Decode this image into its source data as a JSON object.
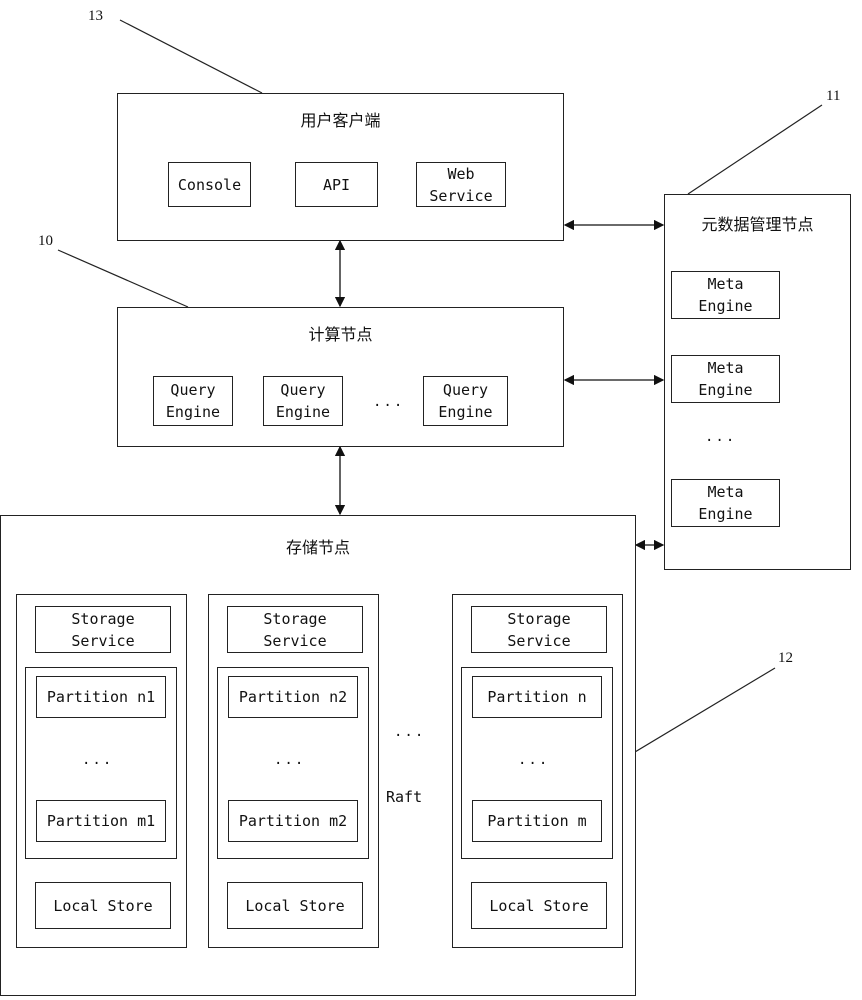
{
  "refs": {
    "client": "13",
    "meta": "11",
    "compute": "10",
    "storage": "12"
  },
  "client": {
    "title": "用户客户端",
    "items": [
      "Console",
      "API",
      "Web\nService"
    ]
  },
  "compute": {
    "title": "计算节点",
    "engines": [
      "Query\nEngine",
      "Query\nEngine",
      "Query\nEngine"
    ],
    "ellipsis": "..."
  },
  "meta": {
    "title": "元数据管理节点",
    "engines": [
      "Meta\nEngine",
      "Meta\nEngine",
      "Meta\nEngine"
    ],
    "ellipsis": "..."
  },
  "storage": {
    "title": "存储节点",
    "nodes": [
      {
        "service": "Storage\nService",
        "partition_top": "Partition n1",
        "partition_bottom": "Partition m1",
        "ellipsis": "...",
        "local": "Local Store"
      },
      {
        "service": "Storage\nService",
        "partition_top": "Partition n2",
        "partition_bottom": "Partition m2",
        "ellipsis": "...",
        "local": "Local Store"
      },
      {
        "service": "Storage\nService",
        "partition_top": "Partition n",
        "partition_bottom": "Partition m",
        "ellipsis": "...",
        "local": "Local Store"
      }
    ],
    "between_ellipsis": "...",
    "raft_label": "Raft"
  }
}
